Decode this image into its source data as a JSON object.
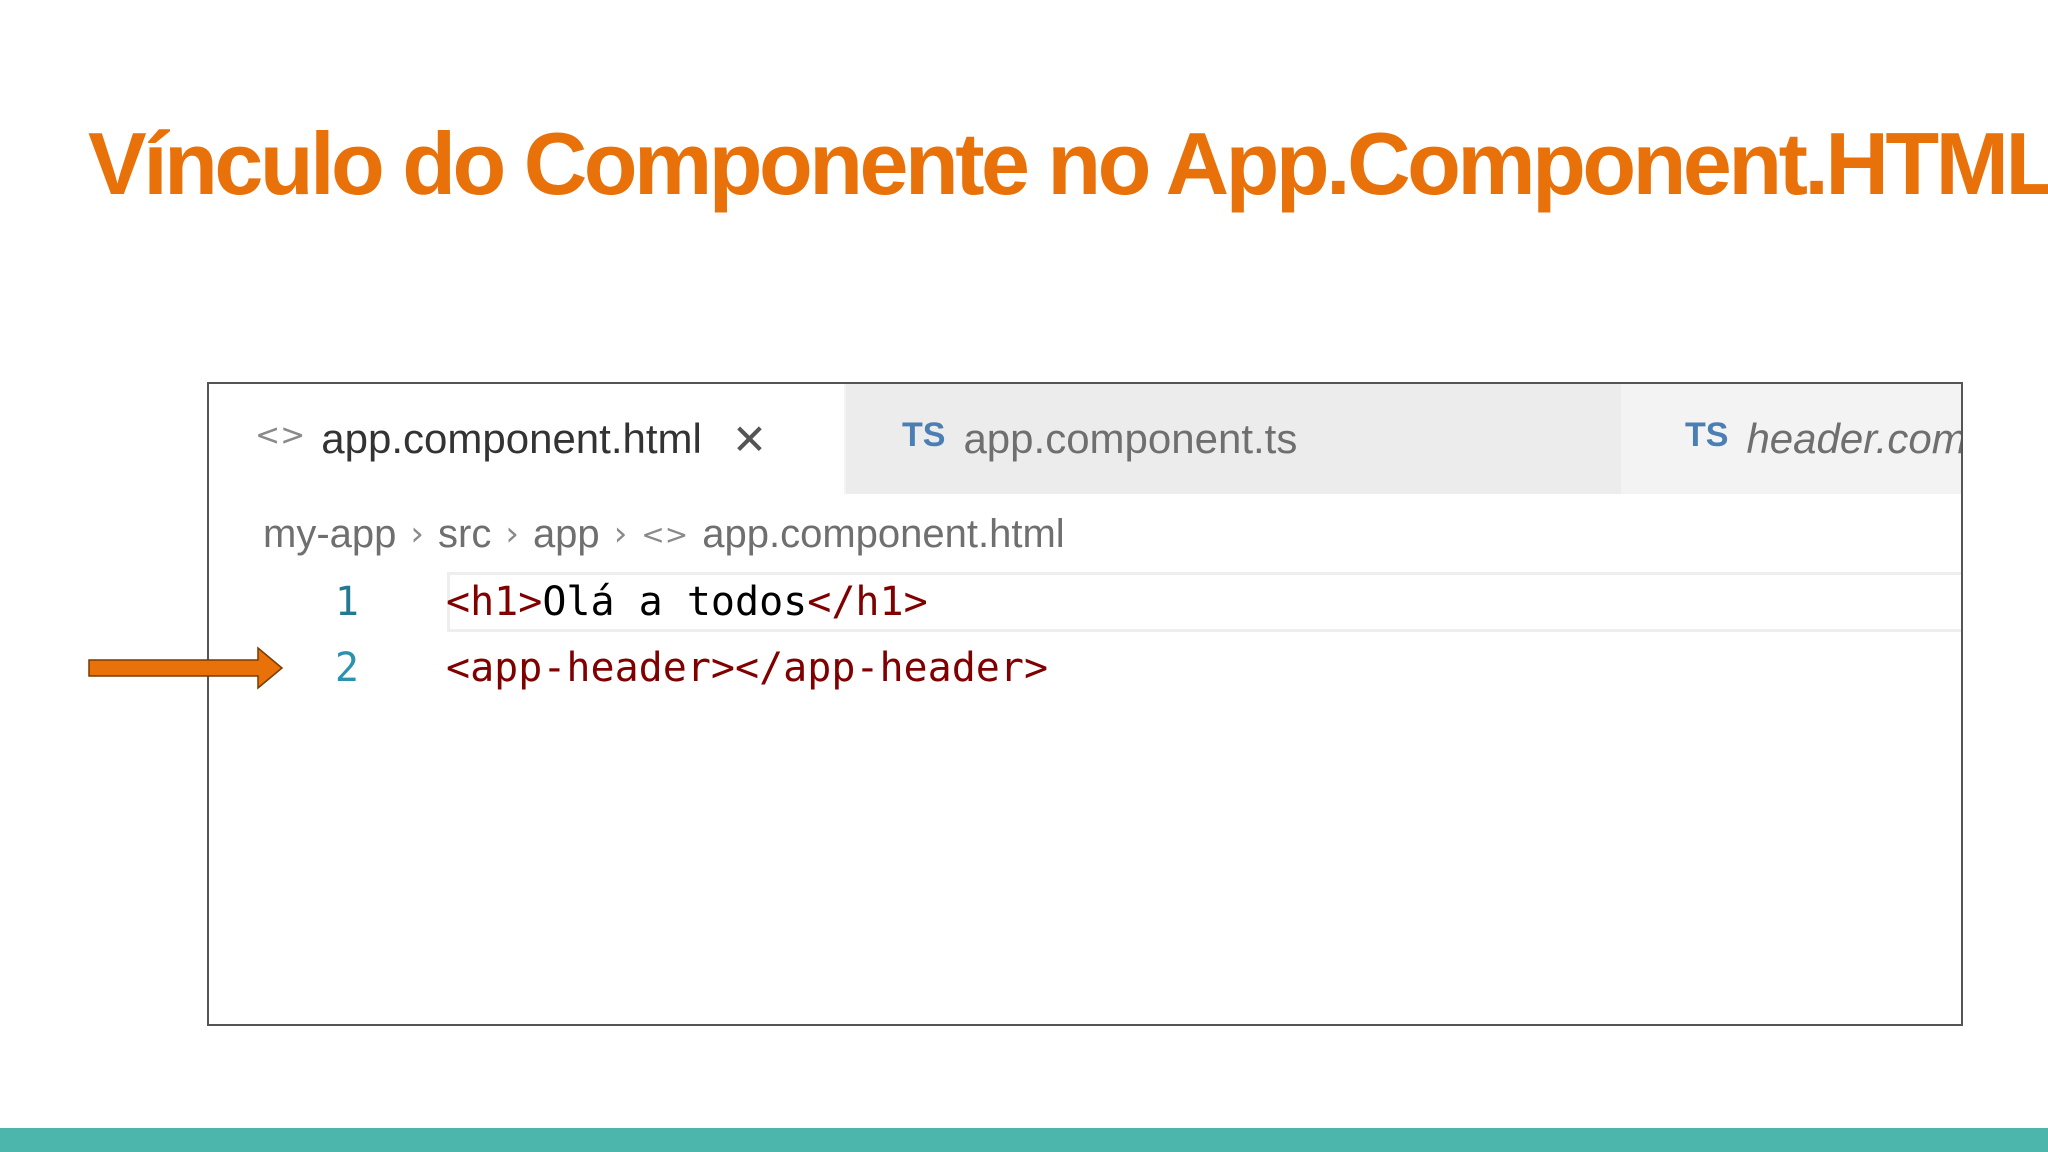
{
  "slide": {
    "title": "Vínculo do Componente no App.Component.HTML"
  },
  "editor": {
    "tabs": [
      {
        "label": "app.component.html",
        "icon": "html-brackets-icon",
        "active": true,
        "close": "✕"
      },
      {
        "label": "app.component.ts",
        "icon": "typescript-icon",
        "icon_text": "TS",
        "active": false
      },
      {
        "label": "header.component.ts",
        "icon": "typescript-icon",
        "icon_text": "TS",
        "active": false,
        "italic": true
      }
    ],
    "breadcrumb": [
      "my-app",
      "src",
      "app",
      "app.component.html"
    ],
    "lines": [
      {
        "number": "1",
        "tokens": [
          "<h1>",
          "Olá a todos",
          "</h1>"
        ]
      },
      {
        "number": "2",
        "tokens": [
          "<app-header>",
          "</app-header>"
        ]
      }
    ]
  },
  "colors": {
    "title": "#e8710a",
    "arrow": "#e8710a",
    "bottom_bar": "#4db6ac",
    "tag": "#800000",
    "line_number": "#237893",
    "ts_icon": "#4b7fb3"
  }
}
